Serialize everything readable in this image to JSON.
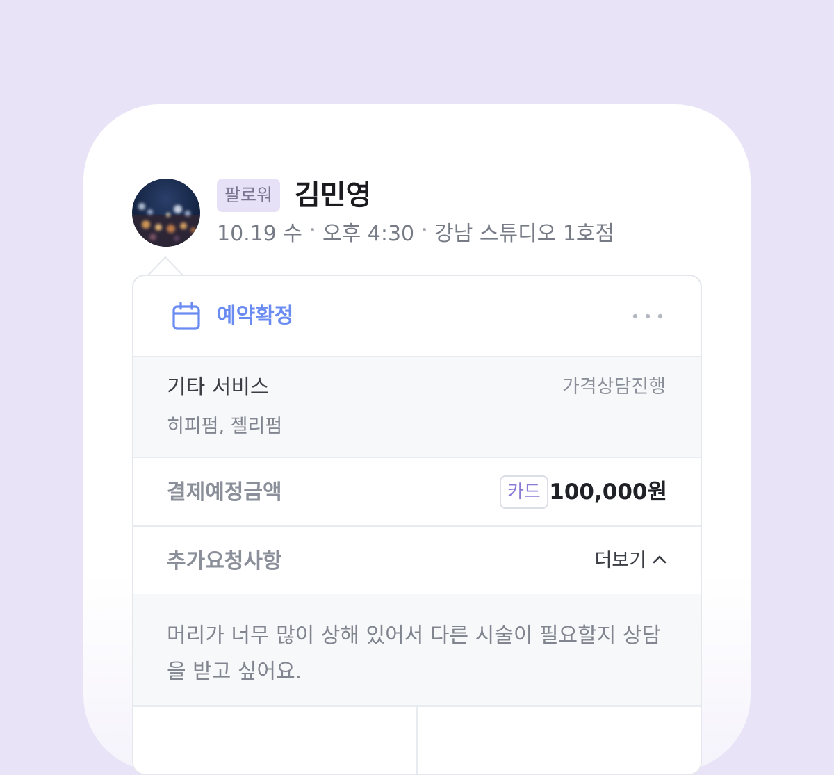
{
  "profile": {
    "badge": "팔로워",
    "name": "김민영",
    "date": "10.19 수",
    "time": "오후 4:30",
    "location": "강남 스튜디오 1호점"
  },
  "booking": {
    "status": "예약확정",
    "status_color": "#6a8bf2",
    "status_icon": "calendar-icon",
    "more_icon": "ellipsis-icon"
  },
  "service": {
    "name": "기타 서비스",
    "price": "가격상담진행",
    "detail": "히피펌, 젤리펌"
  },
  "payment": {
    "label": "결제예정금액",
    "method": "카드",
    "amount": "100,000원"
  },
  "request": {
    "label": "추가요청사항",
    "toggle_label": "더보기",
    "toggle_icon": "chevron-up-icon",
    "text": "머리가 너무 많이 상해 있어서 다른 시술이 필요할지 상담을 받고 싶어요."
  },
  "colors": {
    "background": "#e8e3f7",
    "accent": "#6a8bf2",
    "card_method": "#8a7ad6"
  }
}
